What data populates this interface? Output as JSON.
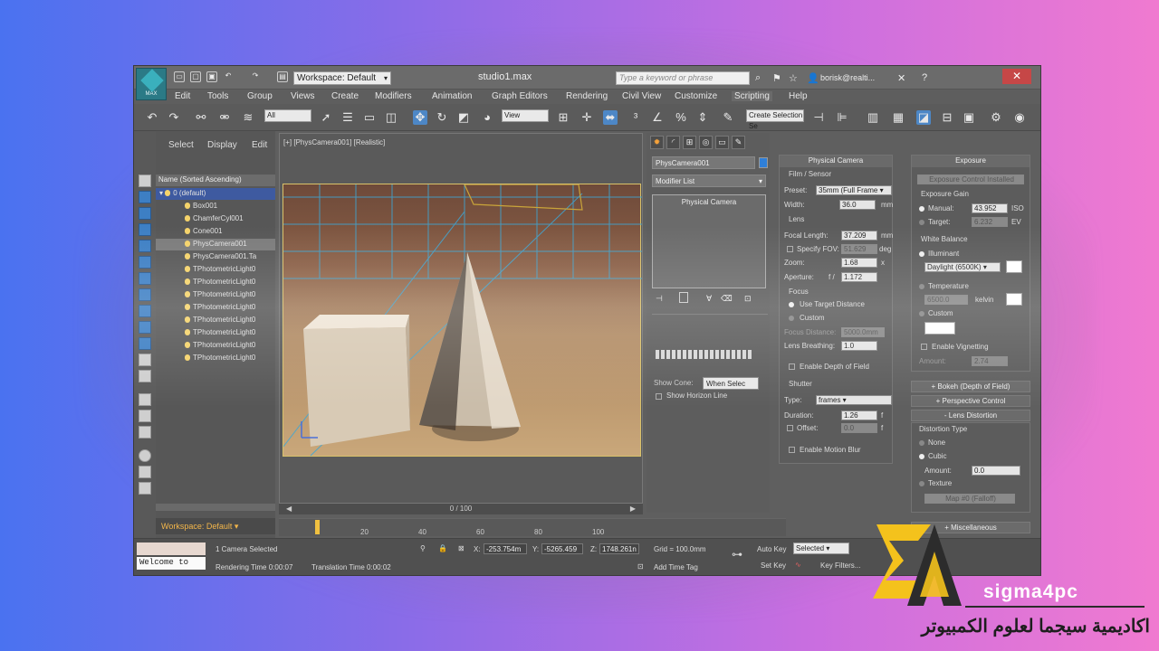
{
  "app": {
    "logo_text": "MAX",
    "workspace_dropdown": "Workspace: Default",
    "window_title": "studio1.max",
    "search_placeholder": "Type a keyword or phrase",
    "user": "borisk@realti..."
  },
  "menu": [
    "Edit",
    "Tools",
    "Group",
    "Views",
    "Create",
    "Modifiers",
    "Animation",
    "Graph Editors",
    "Rendering",
    "Civil View",
    "Customize",
    "Scripting",
    "Help"
  ],
  "menu_active": "Scripting",
  "toolbar": {
    "filter_dropdown": "All",
    "ref_coord_dropdown": "View",
    "selection_set_dropdown": "Create Selection Se"
  },
  "explorer": {
    "tabs": [
      "Select",
      "Display",
      "Edit"
    ],
    "header": "Name (Sorted Ascending)",
    "items": [
      "0 (default)",
      "Box001",
      "ChamferCyl001",
      "Cone001",
      "PhysCamera001",
      "PhysCamera001.Ta",
      "TPhotometricLight0",
      "TPhotometricLight0",
      "TPhotometricLight0",
      "TPhotometricLight0",
      "TPhotometricLight0",
      "TPhotometricLight0",
      "TPhotometricLight0",
      "TPhotometricLight0"
    ],
    "selected_index": 4,
    "workspace_label": "Workspace: Default"
  },
  "viewport": {
    "label": "[+] [PhysCamera001] [Realistic]",
    "frame_readout": "0 / 100"
  },
  "ruler_ticks": [
    "20",
    "40",
    "60",
    "80",
    "100"
  ],
  "command_panel": {
    "object_name": "PhysCamera001",
    "modifier_list": "Modifier List",
    "stack_item": "Physical Camera",
    "show_cone_dropdown": "When Selec",
    "show_cone_label": "Show Cone:",
    "show_horizon": "Show Horizon Line"
  },
  "physical_camera": {
    "title": "Physical Camera",
    "film_sensor": "Film / Sensor",
    "preset_label": "Preset:",
    "preset_value": "35mm (Full Frame",
    "width_label": "Width:",
    "width_value": "36.0",
    "width_unit": "mm",
    "lens": "Lens",
    "focal_length_label": "Focal Length:",
    "focal_length_value": "37.209",
    "focal_length_unit": "mm",
    "specify_fov_label": "Specify FOV:",
    "specify_fov_value": "51.629",
    "specify_fov_unit": "deg",
    "zoom_label": "Zoom:",
    "zoom_value": "1.68",
    "zoom_unit": "x",
    "aperture_label": "Aperture:",
    "aperture_f": "f /",
    "aperture_value": "1.172",
    "focus": "Focus",
    "use_target_distance": "Use Target Distance",
    "custom": "Custom",
    "focus_distance_label": "Focus Distance:",
    "focus_distance_value": "5000.0mm",
    "lens_breathing_label": "Lens Breathing:",
    "lens_breathing_value": "1.0",
    "enable_dof": "Enable Depth of Field",
    "shutter": "Shutter",
    "type_label": "Type:",
    "type_value": "frames",
    "duration_label": "Duration:",
    "duration_value": "1.26",
    "duration_unit": "f",
    "offset_label": "Offset:",
    "offset_value": "0.0",
    "offset_unit": "f",
    "enable_motion_blur": "Enable Motion Blur"
  },
  "exposure": {
    "title": "Exposure",
    "installed": "Exposure Control Installed",
    "exposure_gain": "Exposure Gain",
    "manual_label": "Manual:",
    "manual_value": "43.952",
    "manual_unit": "ISO",
    "target_label": "Target:",
    "target_value": "6.232",
    "target_unit": "EV",
    "white_balance": "White Balance",
    "illuminant": "Illuminant",
    "illuminant_value": "Daylight (6500K)",
    "temperature": "Temperature",
    "temperature_value": "6500.0",
    "temperature_unit": "kelvin",
    "custom": "Custom",
    "enable_vignetting": "Enable Vignetting",
    "amount_label": "Amount:",
    "amount_value": "2.74"
  },
  "rollouts": {
    "bokeh": "Bokeh (Depth of Field)",
    "perspective": "Perspective Control",
    "lens_distortion": "Lens Distortion",
    "distortion_type": "Distortion Type",
    "none": "None",
    "cubic": "Cubic",
    "amount_label": "Amount:",
    "amount_value": "0.0",
    "texture": "Texture",
    "map": "Map #0 (Falloff)",
    "misc": "Miscellaneous"
  },
  "status": {
    "welcome": "Welcome to",
    "selection": "1 Camera Selected",
    "rendering_time": "Rendering Time  0:00:07",
    "translation_time": "Translation Time  0:00:02",
    "x_label": "X:",
    "x_value": "-253.754m",
    "y_label": "Y:",
    "y_value": "-5265.459",
    "z_label": "Z:",
    "z_value": "1748.261n",
    "grid": "Grid = 100.0mm",
    "add_time_tag": "Add Time Tag",
    "auto_key": "Auto Key",
    "set_key": "Set Key",
    "selected_dropdown": "Selected",
    "key_filters": "Key Filters..."
  },
  "watermark": {
    "brand": "sigma4pc",
    "arabic": "اكاديمية سيجما لعلوم الكمبيوتر"
  }
}
